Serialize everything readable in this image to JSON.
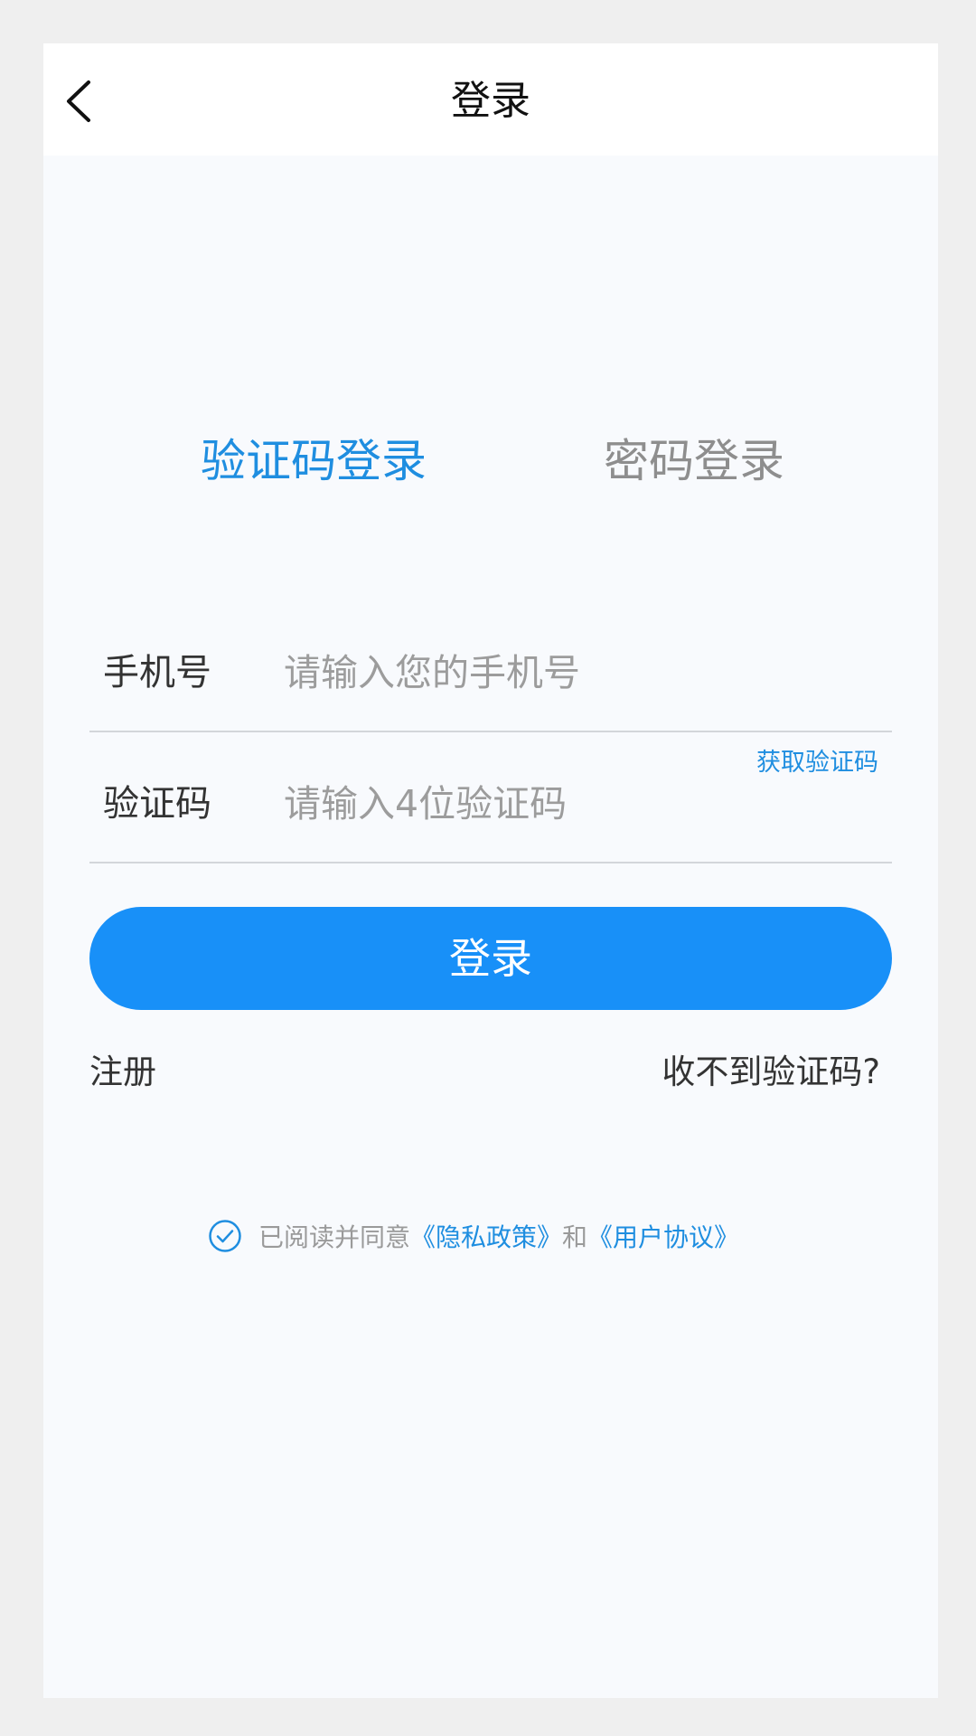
{
  "header": {
    "title": "登录"
  },
  "tabs": [
    {
      "label": "验证码登录",
      "active": true
    },
    {
      "label": "密码登录",
      "active": false
    }
  ],
  "form": {
    "phone": {
      "label": "手机号",
      "placeholder": "请输入您的手机号",
      "value": ""
    },
    "code": {
      "label": "验证码",
      "placeholder": "请输入4位验证码",
      "value": ""
    },
    "get_code_label": "获取验证码"
  },
  "actions": {
    "login_label": "登录",
    "register_label": "注册",
    "no_code_label": "收不到验证码?"
  },
  "agreement": {
    "prefix": "已阅读并同意",
    "privacy_label": "《隐私政策》",
    "conjunction": "和",
    "terms_label": "《用户协议》",
    "checked": true
  },
  "colors": {
    "accent": "#1f8ee0",
    "button": "#1890f8",
    "page_background": "#f8fafd",
    "outer_background": "#efefef"
  },
  "icons": {
    "back": "chevron-left-icon",
    "agreement_check": "check-circle-icon"
  }
}
